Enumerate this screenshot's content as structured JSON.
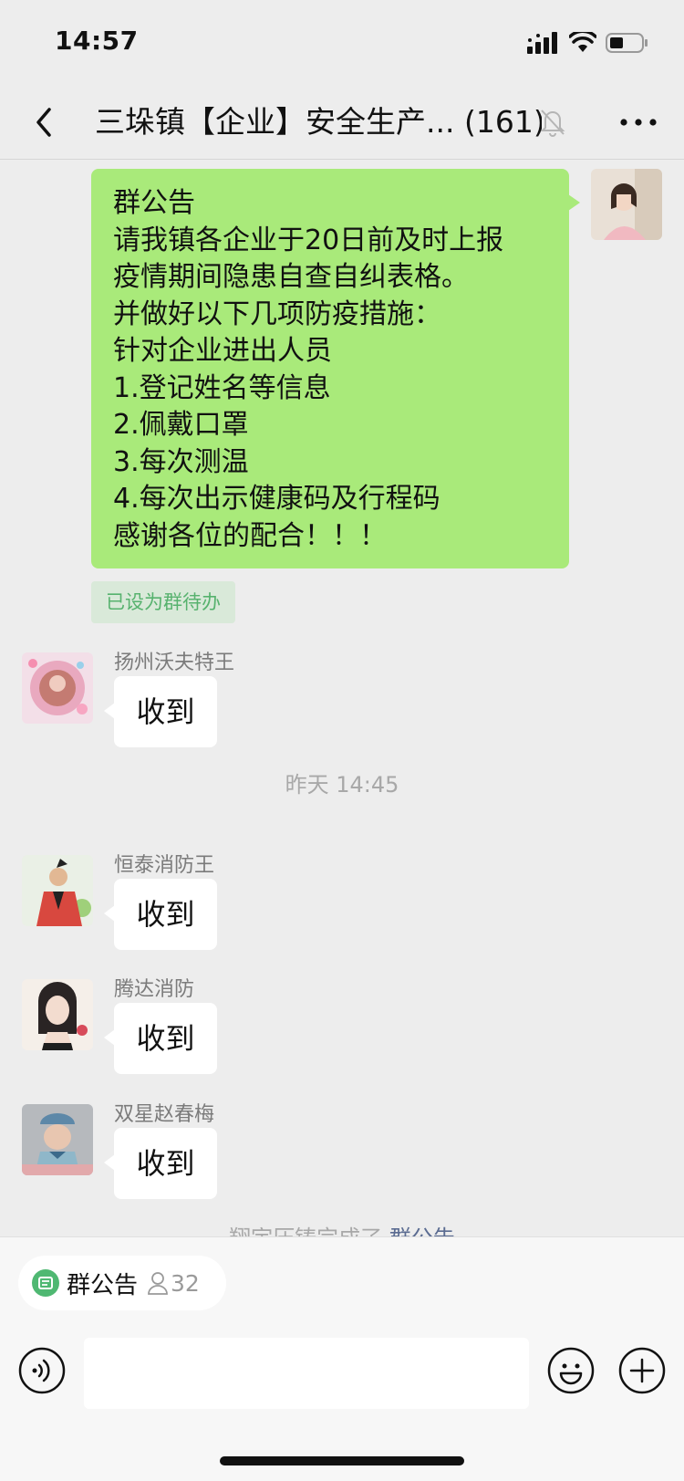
{
  "status_bar": {
    "time": "14:57"
  },
  "nav": {
    "title": "三垛镇【企业】安全生产...",
    "member_count": "(161)",
    "back_icon": "chevron-left-icon",
    "mute_icon": "bell-slash-icon",
    "more_icon": "ellipsis-icon"
  },
  "announcement": {
    "lines": [
      "群公告",
      "请我镇各企业于20日前及时上报",
      "疫情期间隐患自查自纠表格。",
      "并做好以下几项防疫措施：",
      "针对企业进出人员",
      "1.登记姓名等信息",
      "2.佩戴口罩",
      "3.每次测温",
      "4.每次出示健康码及行程码",
      "感谢各位的配合！！！"
    ],
    "todo_tag": "已设为群待办"
  },
  "messages": [
    {
      "sender": "扬州沃夫特王",
      "text": "收到"
    },
    {
      "sender": "恒泰消防王",
      "text": "收到"
    },
    {
      "sender": "腾达消防",
      "text": "收到"
    },
    {
      "sender": "双星赵春梅",
      "text": "收到"
    }
  ],
  "time_separator": "昨天 14:45",
  "system_cut": {
    "text": "翔宇压铸完成了 ",
    "link": "群公告"
  },
  "bottom": {
    "notice_chip_label": "群公告",
    "notice_chip_count": "32"
  },
  "colors": {
    "self_bubble": "#a9ea7a",
    "background": "#ededed",
    "todo_text": "#57b26e"
  }
}
